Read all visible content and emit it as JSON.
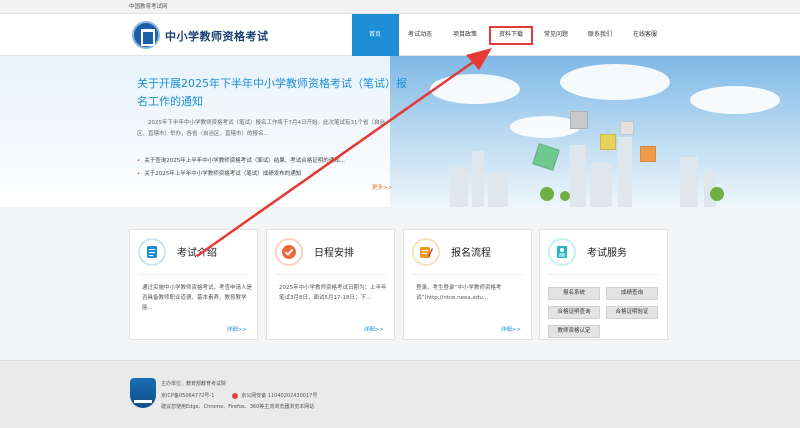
{
  "topbar": {
    "site_name": "中国教育考试网"
  },
  "header": {
    "logo_text": "中小学教师资格考试",
    "nav": [
      {
        "label": "首页"
      },
      {
        "label": "考试动态"
      },
      {
        "label": "项目政策"
      },
      {
        "label": "资料下载"
      },
      {
        "label": "常见问题"
      },
      {
        "label": "联系我们"
      },
      {
        "label": "在线客服"
      }
    ]
  },
  "banner": {
    "title": "关于开展2025年下半年中小学教师资格考试（笔试）报名工作的通知",
    "body": "2025年下半年中小学教师资格考试（笔试）报名工作将于7月4日开始。此次笔试有31个省（自治区、直辖市）举办，各省（自治区、直辖市）的报名...",
    "links": [
      "关于查询2025年上半年中小学教师资格考试（面试）结果、考试合格证明的通知...",
      "关于2025年上半年中小学教师资格考试（笔试）成绩发布的通知"
    ],
    "more": "更多>>"
  },
  "cards": [
    {
      "icon": "document-icon",
      "title": "考试介绍",
      "text": "通过实施中小学教师资格考试，考查申请人是否具备教师职业道德、基本素养、教育教学能...",
      "more": "详细>>"
    },
    {
      "icon": "checkmark-icon",
      "title": "日程安排",
      "text": "2025年中小学教师资格考试日期为：上半年笔试3月8日，面试5月17-18日；下...",
      "more": "详细>>"
    },
    {
      "icon": "pencil-form-icon",
      "title": "报名流程",
      "text": "登录。考生登录“中小学教师资格考试”(http://ntce.neea.edu...",
      "more": "详细>>"
    },
    {
      "icon": "id-card-icon",
      "title": "考试服务",
      "buttons": [
        "报名系统",
        "成绩查询",
        "合格证明查询",
        "合格证明验证",
        "教师资格认定"
      ]
    }
  ],
  "footer": {
    "line1": "主办单位：教育部教育考试院",
    "icp": "京ICP备05064772号-1",
    "police": "京公网安备 11040202430017号",
    "browser": "建议您使用Edge、Chrome、Firefox、360等主流浏览器浏览本网站"
  },
  "colors": {
    "accent": "#1e8fd5",
    "highlight": "#e53935",
    "title_blue": "#1a90d8"
  }
}
